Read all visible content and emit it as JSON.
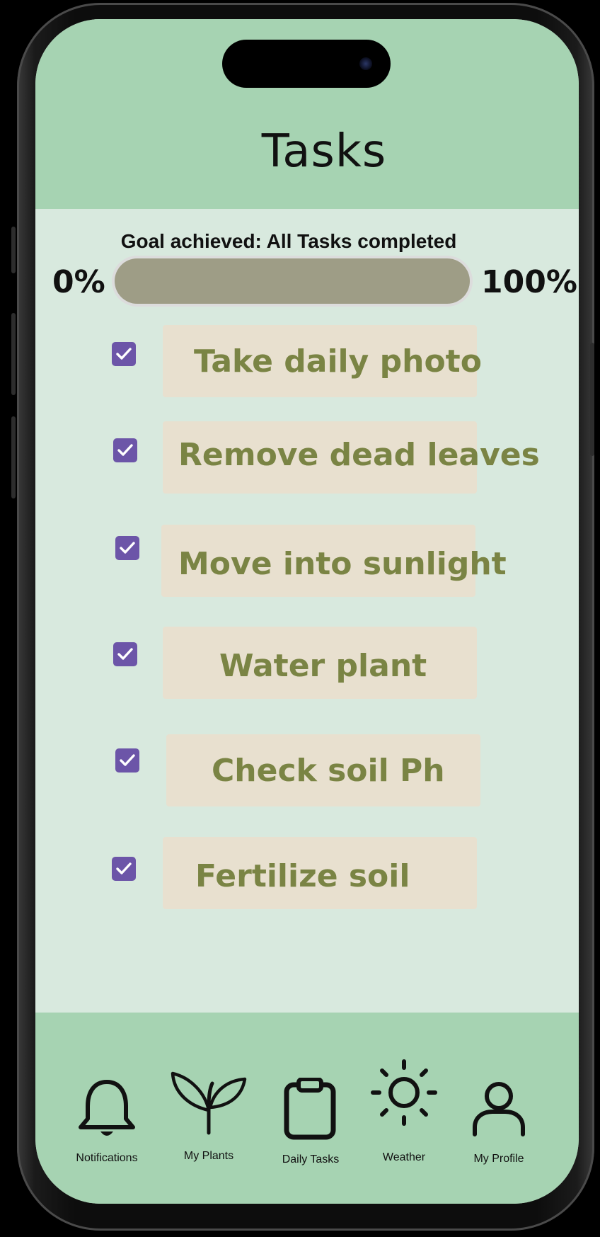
{
  "screen": {
    "title": "Tasks",
    "goal_text": "Goal achieved: All Tasks completed"
  },
  "progress": {
    "min_label": "0%",
    "max_label": "100%",
    "value_percent": 100
  },
  "tasks": [
    {
      "label": "Take daily photo",
      "checked": true
    },
    {
      "label": "Remove dead leaves",
      "checked": true
    },
    {
      "label": "Move into sunlight",
      "checked": true
    },
    {
      "label": "Water plant",
      "checked": true
    },
    {
      "label": "Check soil Ph",
      "checked": true
    },
    {
      "label": "Fertilize soil",
      "checked": true
    }
  ],
  "tabbar": {
    "items": [
      {
        "label": "Notifications",
        "icon": "bell-icon"
      },
      {
        "label": "My Plants",
        "icon": "sprout-icon"
      },
      {
        "label": "Daily Tasks",
        "icon": "clipboard-icon"
      },
      {
        "label": "Weather",
        "icon": "sun-icon"
      },
      {
        "label": "My Profile",
        "icon": "user-icon"
      }
    ]
  },
  "colors": {
    "header_green": "#a6d3b2",
    "content_bg": "#d8e9de",
    "checkbox_purple": "#6c55a8",
    "task_card": "#e8e0cf",
    "task_text": "#7a8444",
    "progress_fill": "#9e9d86"
  }
}
